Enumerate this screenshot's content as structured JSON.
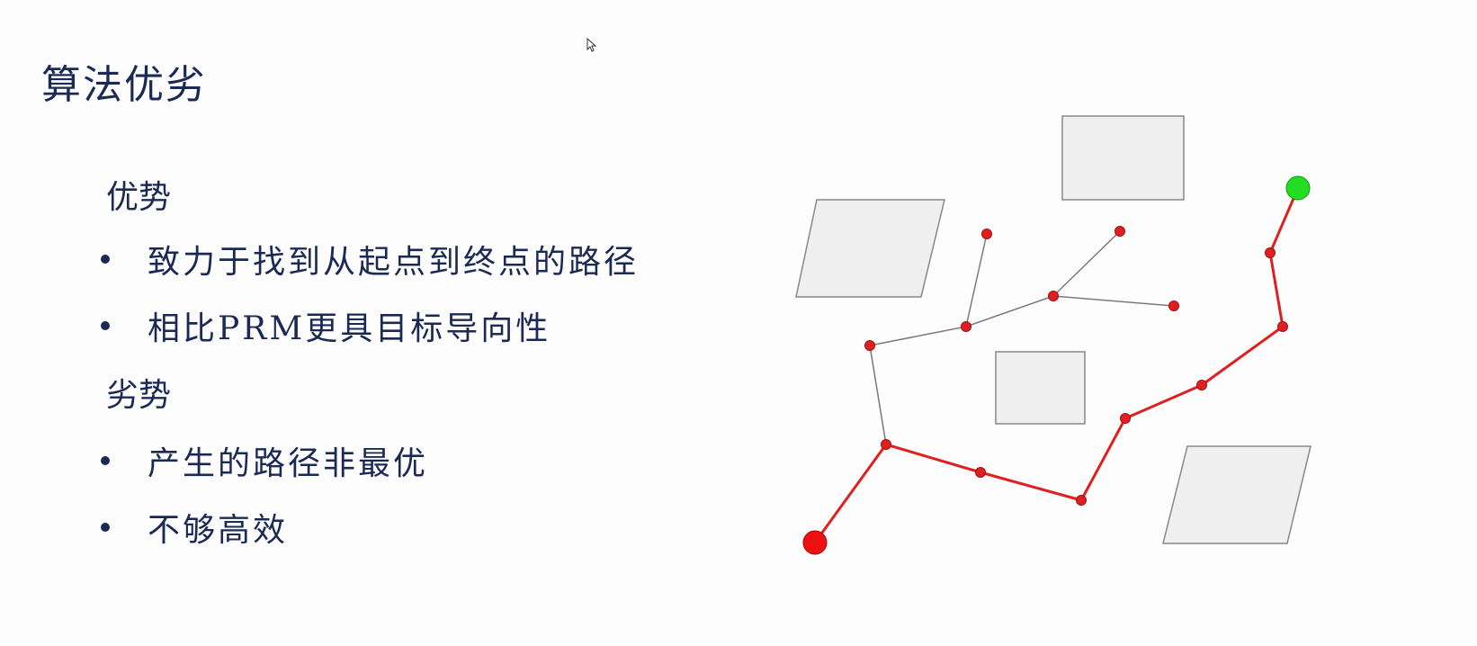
{
  "title": "算法优劣",
  "sections": [
    {
      "heading": "优势",
      "items": [
        "致力于找到从起点到终点的路径",
        "相比PRM更具目标导向性"
      ]
    },
    {
      "heading": "劣势",
      "items": [
        "产生的路径非最优",
        "不够高效"
      ]
    }
  ],
  "colors": {
    "text": "#1b2a55",
    "obstacle_fill": "#efefef",
    "obstacle_stroke": "#888888",
    "path": "#e02020",
    "node": "#e02020",
    "tree_edge": "#7a7a7a",
    "start": "#ee1111",
    "goal": "#22dd22"
  }
}
